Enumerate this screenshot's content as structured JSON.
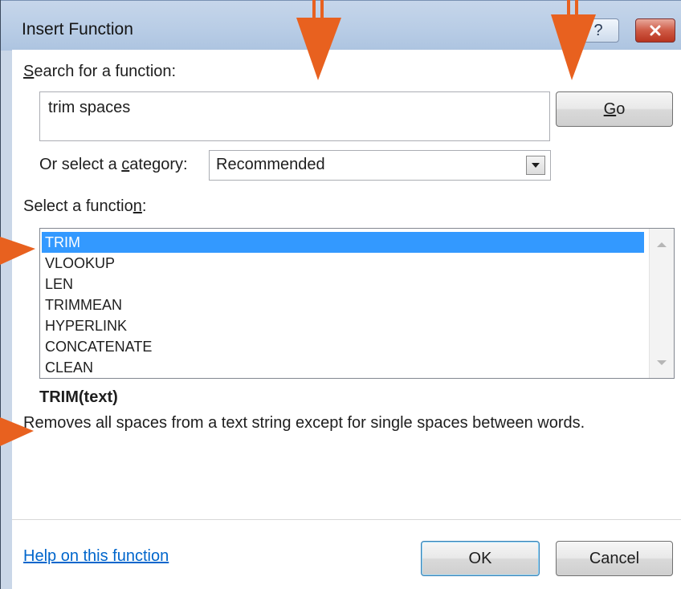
{
  "window": {
    "title": "Insert Function",
    "help_glyph": "?"
  },
  "search": {
    "label_prefix": "",
    "label_accesskey": "S",
    "label_rest": "earch for a function:",
    "value": "trim spaces",
    "go_button": {
      "prefix": "",
      "accesskey": "G",
      "rest": "o"
    }
  },
  "category": {
    "label_prefix": "Or select a ",
    "label_accesskey": "c",
    "label_rest": "ategory:",
    "selected": "Recommended"
  },
  "function_list": {
    "label_prefix": "Select a functio",
    "label_accesskey": "n",
    "label_rest": ":",
    "items": [
      "TRIM",
      "VLOOKUP",
      "LEN",
      "TRIMMEAN",
      "HYPERLINK",
      "CONCATENATE",
      "CLEAN"
    ],
    "selected_index": 0
  },
  "details": {
    "signature": "TRIM(text)",
    "description": "Removes all spaces from a text string except for single spaces between words."
  },
  "footer": {
    "help_link": "Help on this function",
    "ok_label": "OK",
    "cancel_label": "Cancel"
  },
  "colors": {
    "annotation_arrow": "#e8611f",
    "selection": "#3399ff",
    "link": "#0066cc"
  },
  "icons": [
    "help-icon",
    "close-icon",
    "dropdown-arrow-icon",
    "scroll-up-icon",
    "scroll-down-icon"
  ]
}
